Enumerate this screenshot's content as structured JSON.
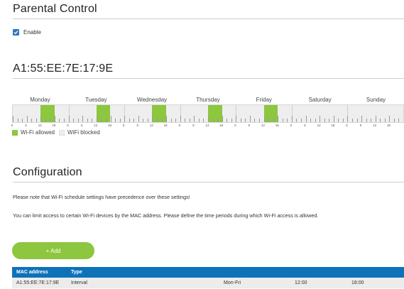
{
  "parental_control": {
    "title": "Parental Control",
    "enable_label": "Enable",
    "enabled": true
  },
  "device": {
    "mac_title": "A1:55:EE:7E:17:9E"
  },
  "schedule": {
    "days": [
      "Monday",
      "Tuesday",
      "Wednesday",
      "Thursday",
      "Friday",
      "Saturday",
      "Sunday"
    ],
    "tick_labels": [
      "0",
      "6",
      "12",
      "18"
    ],
    "allowed_days": [
      "Monday",
      "Tuesday",
      "Wednesday",
      "Thursday",
      "Friday"
    ],
    "allowed_start": "12:00",
    "allowed_end": "18:00",
    "colors": {
      "allowed": "#8dc63f",
      "blocked": "#eeeeee"
    }
  },
  "legend": {
    "allowed": "Wi-Fi allowed",
    "blocked": "WiFi blocked"
  },
  "configuration": {
    "title": "Configuration",
    "note1": "Please note that Wi-Fi schedule settings have precedence over these settings!",
    "note2": "You can limit access to certain Wi-Fi devices by the MAC address. Please define the time periods during which Wi-Fi access is allowed.",
    "add_label": "+ Add"
  },
  "table": {
    "headers": {
      "mac": "MAC address",
      "type": "Type"
    },
    "rows": [
      {
        "mac": "A1:55:EE:7E:17:9E",
        "type": "Interval",
        "days": "Mon-Fri",
        "start": "12:00",
        "end": "18:00"
      }
    ]
  },
  "colors": {
    "accent_green": "#8dc63f",
    "header_blue": "#0d72b8",
    "checkbox_blue": "#2e76c7"
  }
}
